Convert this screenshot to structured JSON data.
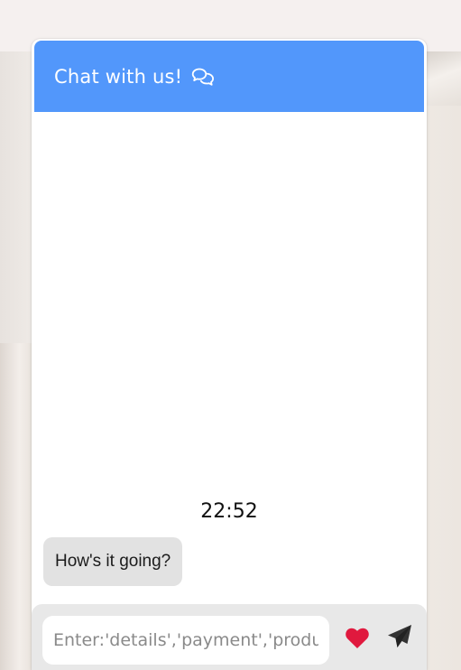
{
  "header": {
    "title": "Chat with us!",
    "icon": "comments-icon"
  },
  "messages": {
    "timestamp": "22:52",
    "items": [
      {
        "text": "How's it going?"
      }
    ]
  },
  "footer": {
    "input_placeholder": "Enter:'details','payment','products'",
    "input_value": "",
    "heart_icon": "heart-icon",
    "send_icon": "send-icon"
  },
  "colors": {
    "header": "#5297fb",
    "bubble": "#e2e2e2",
    "heart": "#e0193e",
    "send": "#333333",
    "footer": "#e8e8e8"
  }
}
